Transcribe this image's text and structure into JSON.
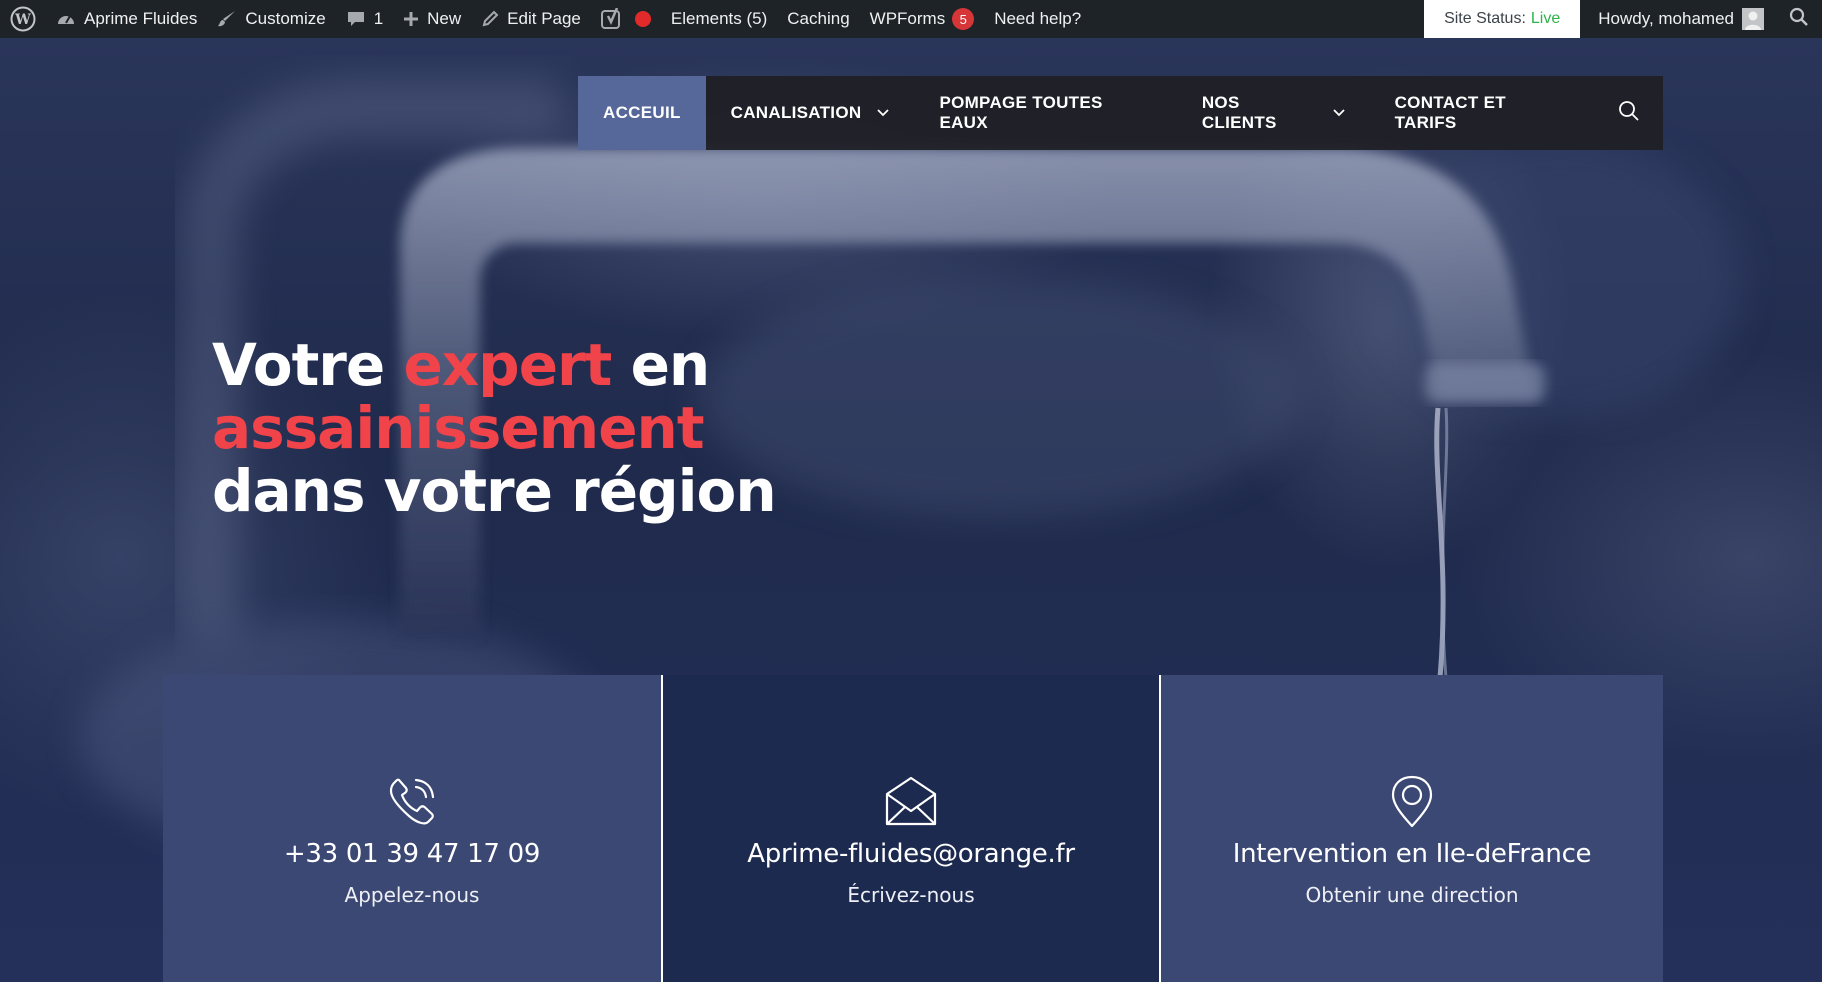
{
  "adminbar": {
    "site_name": "Aprime Fluides",
    "customize": "Customize",
    "comments_count": "1",
    "new": "New",
    "edit_page": "Edit Page",
    "elements": "Elements (5)",
    "caching": "Caching",
    "wpforms": "WPForms",
    "wpforms_badge": "5",
    "need_help": "Need help?",
    "site_status_label": "Site Status:",
    "site_status_value": "Live",
    "howdy": "Howdy, mohamed"
  },
  "nav": {
    "items": [
      {
        "label": "ACCEUIL",
        "active": true
      },
      {
        "label": "CANALISATION",
        "dropdown": true
      },
      {
        "label": "POMPAGE TOUTES EAUX"
      },
      {
        "label": "NOS CLIENTS",
        "dropdown": true
      },
      {
        "label": "CONTACT ET TARIFS"
      }
    ]
  },
  "hero": {
    "line1_a": "Votre",
    "line1_accent": "expert",
    "line1_b": "en",
    "line2_accent": "assainissement",
    "line3": "dans votre région"
  },
  "cards": [
    {
      "icon": "phone-icon",
      "title": "+33 01 39 47 17 09",
      "subtitle": "Appelez-nous"
    },
    {
      "icon": "envelope-icon",
      "title": "Aprime-fluides@orange.fr",
      "subtitle": "Écrivez-nous"
    },
    {
      "icon": "location-pin-icon",
      "title": "Intervention en Ile-deFrance",
      "subtitle": "Obtenir une direction"
    }
  ],
  "colors": {
    "adminbar_bg": "#1d2327",
    "accent_red": "#f0434a",
    "nav_active": "#56689a",
    "card_light": "#3b4873",
    "card_dark": "#1d2a50",
    "status_live": "#2fb44b"
  }
}
